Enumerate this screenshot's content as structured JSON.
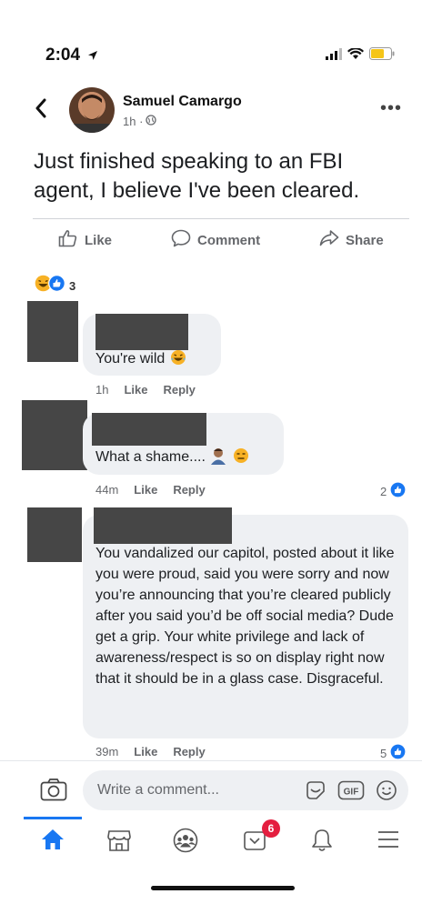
{
  "status_bar": {
    "time": "2:04"
  },
  "post": {
    "author": "Samuel Camargo",
    "time": "1h ·",
    "text": "Just finished speaking to an FBI agent,  I believe I've been cleared.",
    "actions": {
      "like": "Like",
      "comment": "Comment",
      "share": "Share"
    },
    "reaction_count": "3"
  },
  "comments": [
    {
      "text": "You're wild",
      "time": "1h",
      "like_label": "Like",
      "reply_label": "Reply",
      "likes": ""
    },
    {
      "text": "What a shame....",
      "time": "44m",
      "like_label": "Like",
      "reply_label": "Reply",
      "likes": "2"
    },
    {
      "text": "You vandalized our capitol, posted about it like you were proud, said you were sorry and now you’re announcing that you’re cleared publicly after you said you’d be off social media? Dude get a grip. Your white privilege and lack of awareness/respect is so on display right now that it should be in a glass case. Disgraceful.",
      "time": "39m",
      "like_label": "Like",
      "reply_label": "Reply",
      "likes": "5"
    }
  ],
  "composer": {
    "placeholder": "Write a comment...",
    "gif_label": "GIF"
  },
  "tabbar": {
    "notifications_badge": "6"
  },
  "colors": {
    "accent": "#1877f2",
    "badge": "#e41e3f",
    "bubble": "#eef0f3"
  }
}
